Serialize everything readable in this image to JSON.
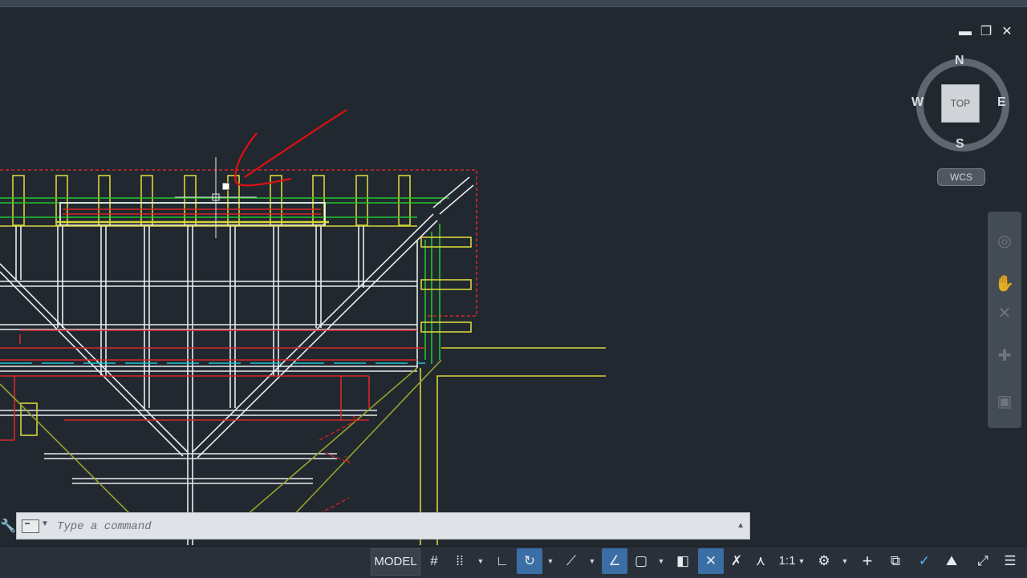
{
  "window": {
    "minimize_icon": "minimize-icon",
    "restore_icon": "restore-icon",
    "close_icon": "close-icon",
    "minimize_glyph": "▬",
    "restore_glyph": "❐",
    "close_glyph": "✕"
  },
  "viewcube": {
    "north": "N",
    "south": "S",
    "east": "E",
    "west": "W",
    "face": "TOP",
    "coord_system": "WCS"
  },
  "navbar": {
    "icons": [
      "full-navigation-wheel-icon",
      "pan-hand-icon",
      "zoom-icon",
      "orbit-icon",
      "showmotion-icon"
    ]
  },
  "command_line": {
    "placeholder": "Type a command",
    "value": ""
  },
  "status_bar": {
    "model_label": "MODEL",
    "scale_label": "1:1",
    "items": [
      "grid-icon",
      "snap-mode-icon",
      "ortho-icon",
      "polar-tracking-icon",
      "isodraft-icon",
      "object-snap-tracking-icon",
      "object-snap-icon",
      "lineweight-icon",
      "transparency-icon",
      "selection-cycling-icon",
      "annotation-visibility-icon",
      "auto-scale-icon",
      "annotation-scale-icon",
      "workspace-gear-icon",
      "annotation-monitor-icon",
      "units-icon",
      "quick-properties-icon",
      "hardware-acceleration-icon",
      "isolate-objects-icon",
      "clean-screen-icon",
      "customization-menu-icon"
    ]
  },
  "colors": {
    "canvas_bg": "#212830",
    "white_geometry": "#e8ecef",
    "yellow_geometry": "#d7d43c",
    "red_geometry": "#d62828",
    "green_geometry": "#27c22a",
    "cyan_geometry": "#1fc6d0",
    "olive_geometry": "#9aa22c",
    "annotation_red": "#e01010",
    "status_active": "#3a6ea5"
  }
}
